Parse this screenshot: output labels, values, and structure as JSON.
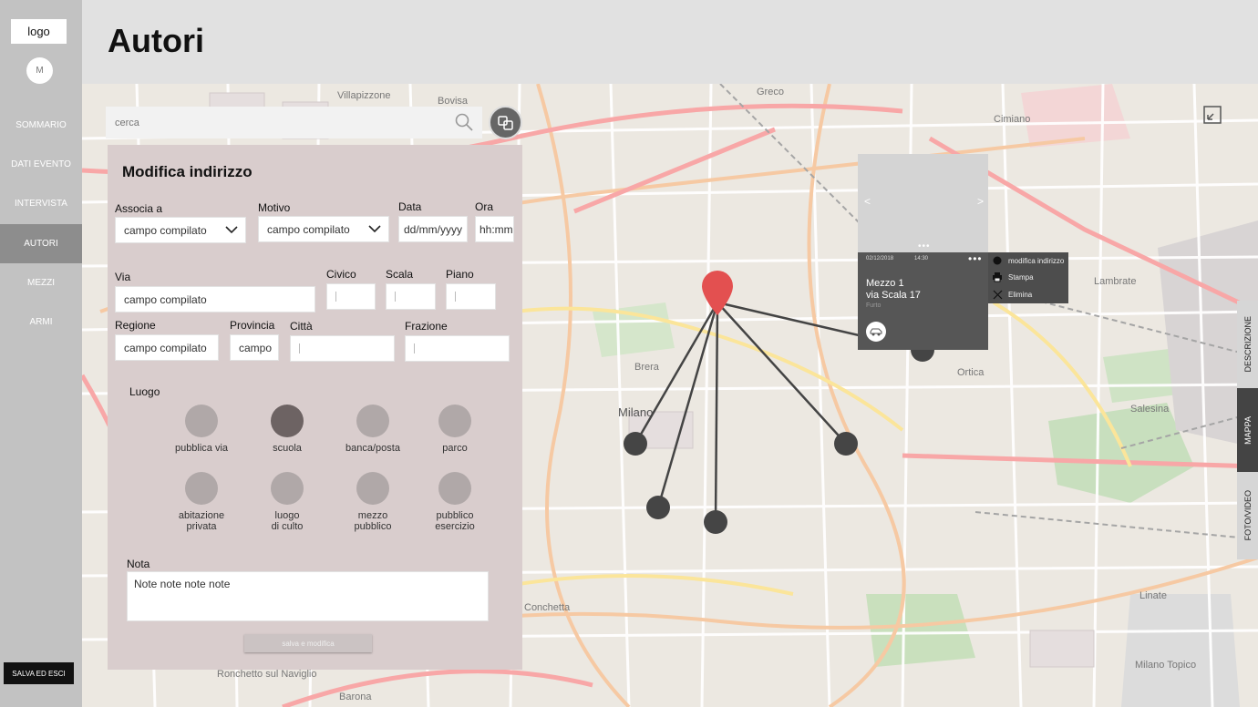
{
  "sidebar": {
    "logo": "logo",
    "avatar_initial": "M",
    "items": [
      {
        "label": "SOMMARIO"
      },
      {
        "label": "DATI EVENTO"
      },
      {
        "label": "INTERVISTA"
      },
      {
        "label": "AUTORI",
        "active": true
      },
      {
        "label": "MEZZI"
      },
      {
        "label": "ARMI"
      }
    ],
    "save_exit": "SALVA ED ESCI"
  },
  "header": {
    "title": "Autori"
  },
  "search": {
    "placeholder": "cerca"
  },
  "form": {
    "title": "Modifica indirizzo",
    "associa": {
      "label": "Associa a",
      "value": "campo compilato"
    },
    "motivo": {
      "label": "Motivo",
      "value": "campo compilato"
    },
    "data": {
      "label": "Data",
      "value": "dd/mm/yyyy"
    },
    "ora": {
      "label": "Ora",
      "value": "hh:mm"
    },
    "via": {
      "label": "Via",
      "value": "campo compilato"
    },
    "civico": {
      "label": "Civico",
      "value": ""
    },
    "scala": {
      "label": "Scala",
      "value": ""
    },
    "piano": {
      "label": "Piano",
      "value": ""
    },
    "regione": {
      "label": "Regione",
      "value": "campo compilato"
    },
    "provincia": {
      "label": "Provincia",
      "value": "campo"
    },
    "citta": {
      "label": "Città",
      "value": ""
    },
    "frazione": {
      "label": "Frazione",
      "value": ""
    },
    "luogo": {
      "label": "Luogo",
      "options": [
        {
          "label": "pubblica via"
        },
        {
          "label": "scuola",
          "selected": true
        },
        {
          "label": "banca/posta"
        },
        {
          "label": "parco"
        },
        {
          "label": "abitazione\nprivata"
        },
        {
          "label": "luogo\ndi culto"
        },
        {
          "label": "mezzo\npubblico"
        },
        {
          "label": "pubblico\nesercizio"
        }
      ]
    },
    "nota": {
      "label": "Nota",
      "value": "Note note note note"
    },
    "submit": "salva e modifica"
  },
  "card": {
    "date": "02/12/2018",
    "time": "14:30",
    "more": "•••",
    "title": "Mezzo 1",
    "address": "via Scala 17",
    "type": "Furto",
    "prev": "<",
    "next": ">",
    "pager": "•••",
    "menu": [
      {
        "label": "modifica indirizzo",
        "icon": "dot-icon"
      },
      {
        "label": "Stampa",
        "icon": "printer-icon"
      },
      {
        "label": "Elimina",
        "icon": "close-icon"
      }
    ]
  },
  "side_tabs": [
    {
      "label": "DESCRIZIONE"
    },
    {
      "label": "MAPPA",
      "active": true
    },
    {
      "label": "FOTO/VIDEO"
    }
  ],
  "map_labels": [
    "Villapizzone",
    "Bovisa",
    "Greco",
    "Cimiano",
    "Brera",
    "Milano",
    "Lambrate",
    "Ortica",
    "Salesina",
    "Conchetta",
    "Ronchetto sul Naviglio",
    "Barona",
    "Linate",
    "Milano Topico"
  ],
  "colors": {
    "sidebar": "#c2c2c2",
    "active_nav": "#8d8d8d",
    "panel": "#d9cdcd",
    "pin": "#e35050",
    "node": "#444444"
  }
}
